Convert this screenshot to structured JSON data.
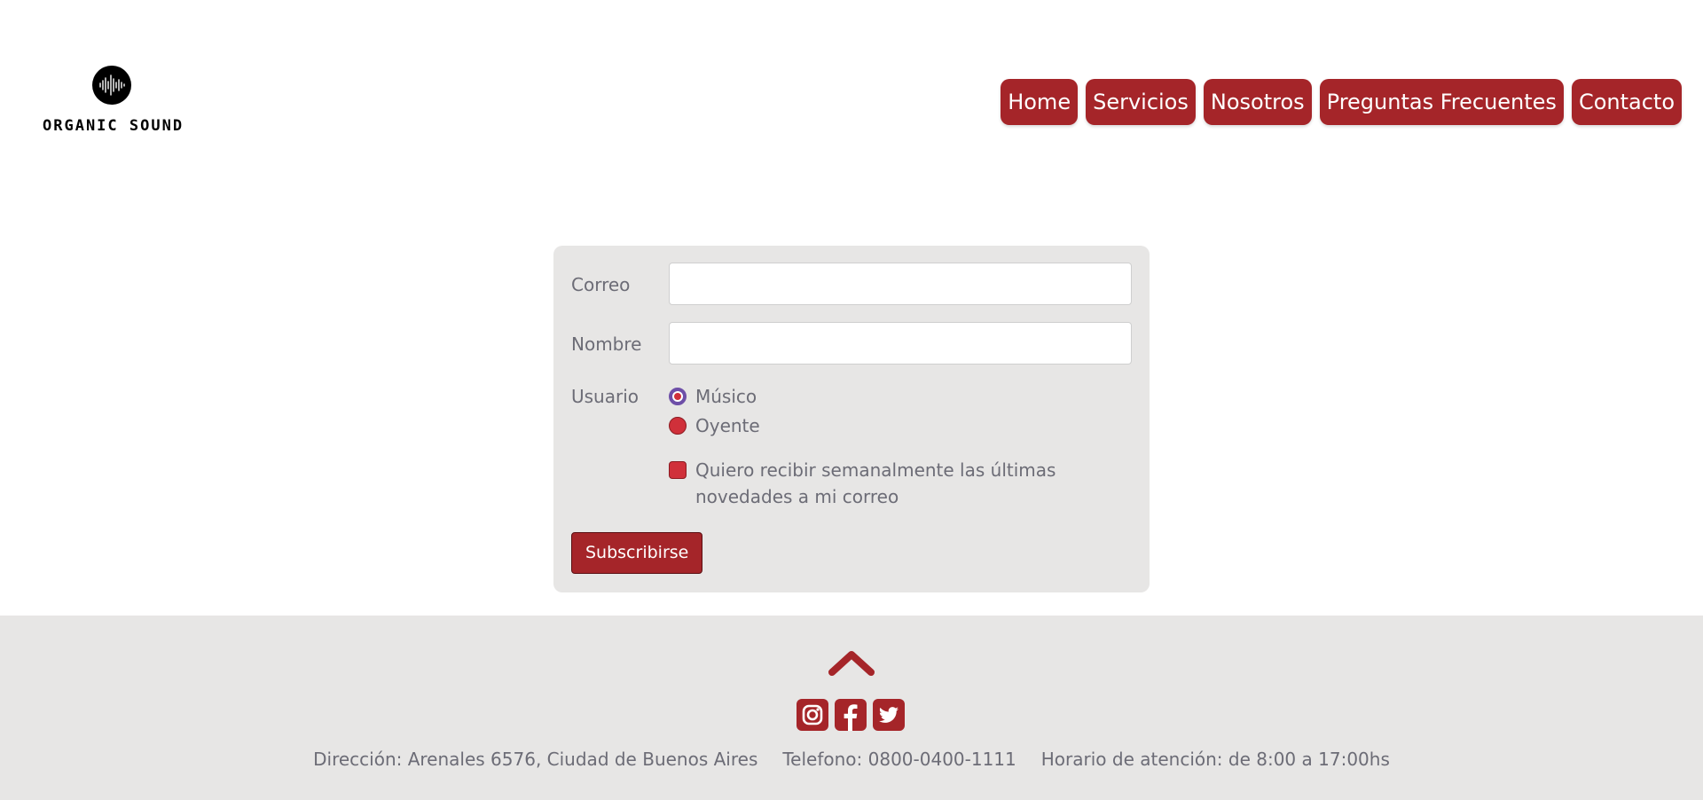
{
  "brand": {
    "name": "ORGANIC SOUND",
    "icon": "soundwave-logo-icon"
  },
  "nav": {
    "items": [
      {
        "label": "Home"
      },
      {
        "label": "Servicios"
      },
      {
        "label": "Nosotros"
      },
      {
        "label": "Preguntas Frecuentes"
      },
      {
        "label": "Contacto"
      }
    ]
  },
  "form": {
    "email_label": "Correo",
    "email_value": "",
    "name_label": "Nombre",
    "name_value": "",
    "user_label": "Usuario",
    "user_options": [
      {
        "label": "Músico",
        "checked": true
      },
      {
        "label": "Oyente",
        "checked": false
      }
    ],
    "newsletter_label": "Quiero recibir semanalmente las últimas novedades a mi correo",
    "newsletter_checked": false,
    "submit_label": "Subscribirse"
  },
  "footer": {
    "back_to_top_icon": "chevron-up-icon",
    "socials": [
      {
        "icon": "instagram-icon"
      },
      {
        "icon": "facebook-icon"
      },
      {
        "icon": "twitter-icon"
      }
    ],
    "address": "Dirección: Arenales 6576, Ciudad de Buenos Aires",
    "phone": "Telefono: 0800-0400-1111",
    "hours": "Horario de atención: de 8:00 a 17:00hs"
  },
  "colors": {
    "accent": "#a52529",
    "control_red": "#d0303a",
    "panel_bg": "#e7e6e5",
    "text_muted": "#6c6c76"
  }
}
